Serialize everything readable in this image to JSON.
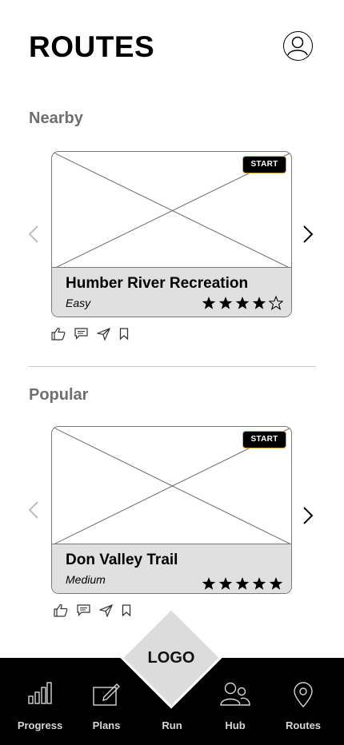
{
  "header": {
    "title": "ROUTES",
    "profile_icon": "user-circle-icon"
  },
  "sections": [
    {
      "label": "Nearby",
      "card": {
        "name": "Humber River Recreation",
        "difficulty": "Easy",
        "rating": 4,
        "max_rating": 5,
        "start_label": "START"
      }
    },
    {
      "label": "Popular",
      "card": {
        "name": "Don Valley Trail",
        "difficulty": "Medium",
        "rating": 5,
        "max_rating": 5,
        "start_label": "START"
      }
    }
  ],
  "actions": [
    "thumbs-up-icon",
    "comment-icon",
    "send-icon",
    "bookmark-icon"
  ],
  "logo": {
    "label": "LOGO"
  },
  "nav": {
    "items": [
      {
        "label": "Progress",
        "icon": "bar-chart-icon"
      },
      {
        "label": "Plans",
        "icon": "edit-icon"
      },
      {
        "label": "Run",
        "icon": ""
      },
      {
        "label": "Hub",
        "icon": "users-icon"
      },
      {
        "label": "Routes",
        "icon": "map-pin-icon"
      }
    ]
  },
  "colors": {
    "nav_bg": "#000000",
    "card_footer": "#e0e0e0",
    "section_label": "#6f6f6f",
    "start_border": "#d9a441"
  }
}
